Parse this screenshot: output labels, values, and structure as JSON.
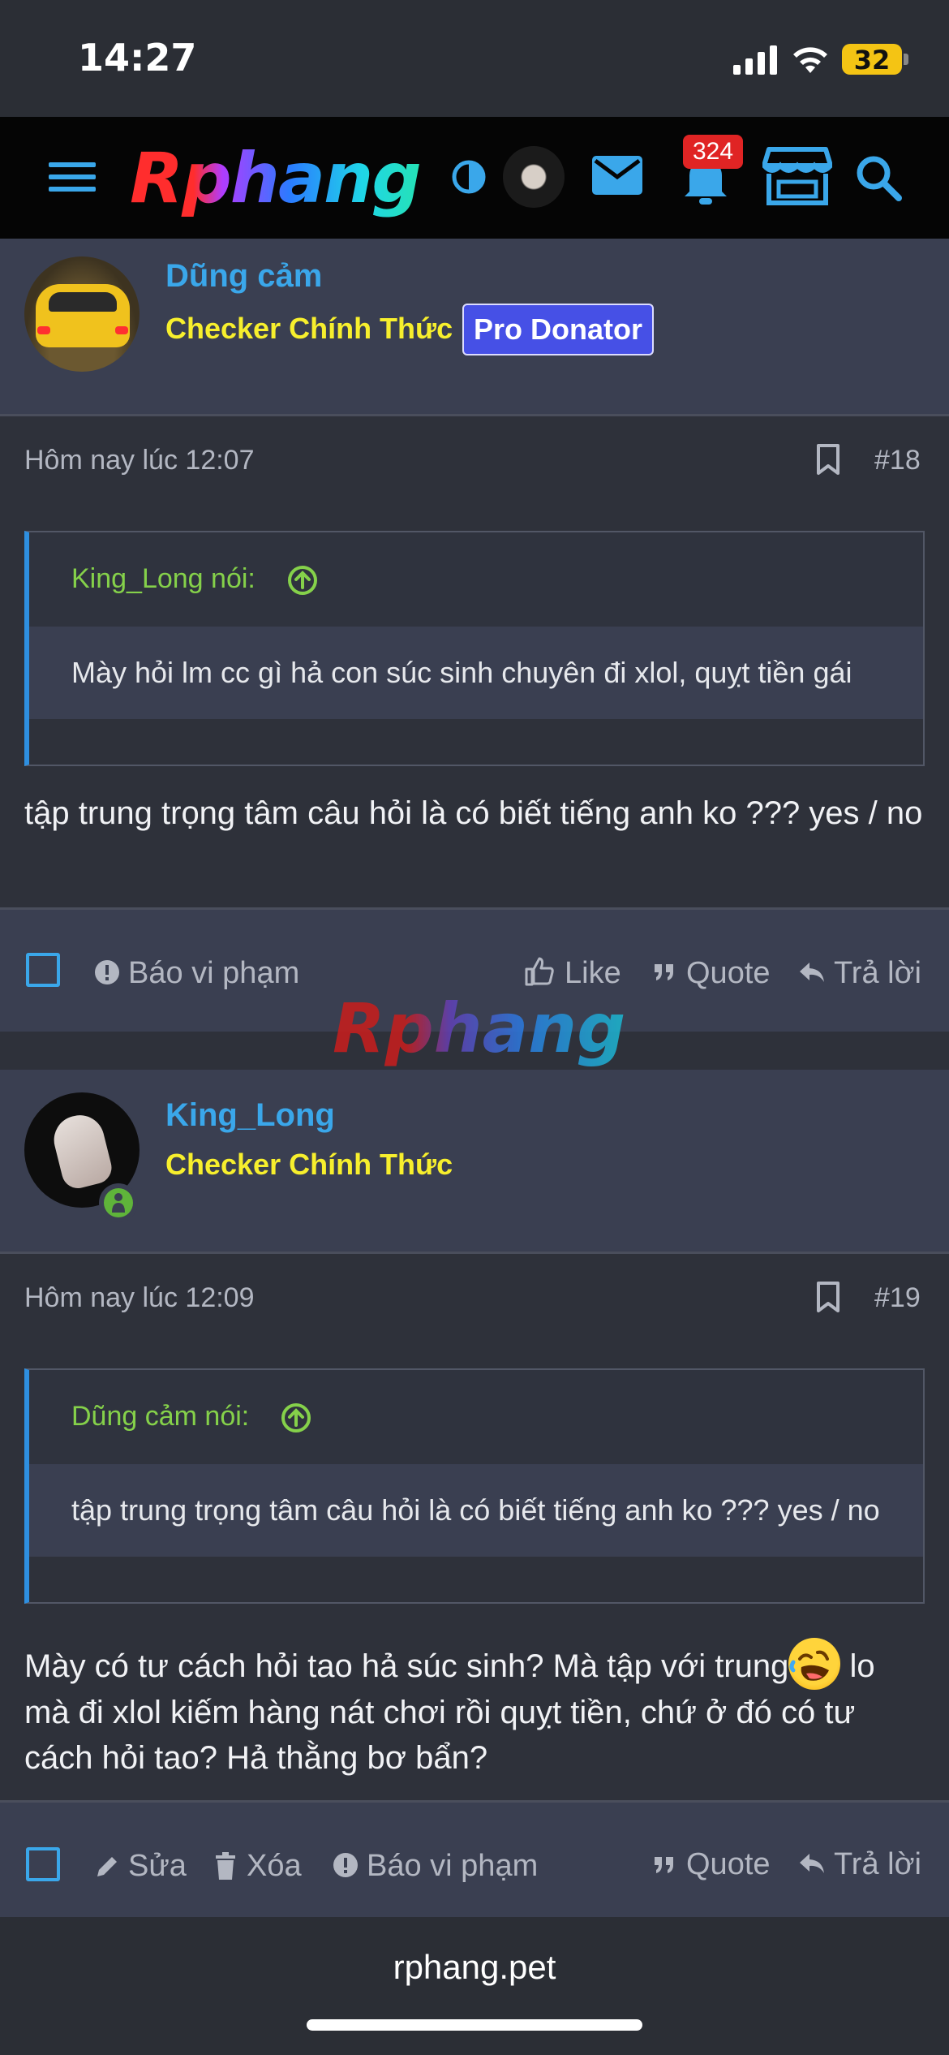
{
  "status_bar": {
    "time": "14:27",
    "battery": "32"
  },
  "nav": {
    "logo_text": "Rphang",
    "notification_count": "324"
  },
  "posts": [
    {
      "username": "Dũng cảm",
      "user_title": "Checker Chính Thức",
      "badge": "Pro Donator",
      "timestamp": "Hôm nay lúc 12:07",
      "post_number": "#18",
      "quote_author": "King_Long nói:",
      "quote_text": "Mày hỏi lm cc gì hả con súc sinh chuyên đi xlol, quỵt tiền gái",
      "text": "tập trung trọng tâm câu hỏi là có biết tiếng anh ko ??? yes / no",
      "actions": {
        "report": "Báo vi phạm",
        "like": "Like",
        "quote": "Quote",
        "reply": "Trả lời"
      }
    },
    {
      "username": "King_Long",
      "user_title": "Checker Chính Thức",
      "timestamp": "Hôm nay lúc 12:09",
      "post_number": "#19",
      "quote_author": "Dũng cảm nói:",
      "quote_text": "tập trung trọng tâm câu hỏi là có biết tiếng anh ko ??? yes / no",
      "text_before_emoji": "Mày có tư cách hỏi tao hả súc sinh? Mà tập với trung",
      "emoji": "rofl-emoji",
      "text_after_emoji": " lo mà đi xlol kiếm hàng nát chơi rồi quỵt tiền, chứ ở đó có tư cách hỏi tao? Hả thằng bơ bẩn?",
      "actions": {
        "edit": "Sửa",
        "delete": "Xóa",
        "report": "Báo vi phạm",
        "quote": "Quote",
        "reply": "Trả lời"
      }
    }
  ],
  "watermark": "Rphang",
  "browser": {
    "url": "rphang.pet"
  },
  "colors": {
    "accent": "#3aa7ea",
    "title_yellow": "#f7ef2d",
    "quote_green": "#85d14a",
    "badge_blue": "#4650e6",
    "notification_red": "#e02424"
  }
}
